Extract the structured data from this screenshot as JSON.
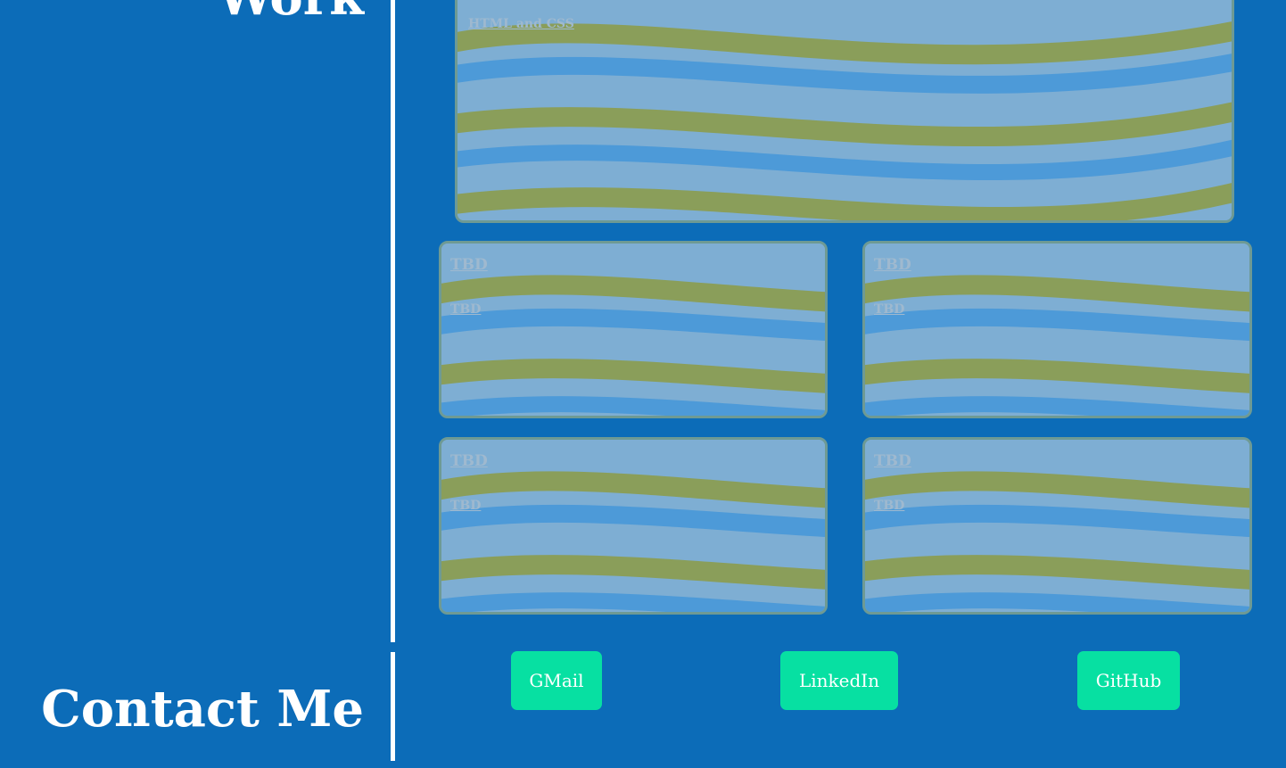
{
  "sections": {
    "work_title": "Work",
    "contact_title": "Contact Me"
  },
  "projects": {
    "featured": {
      "label": "HTML and CSS"
    },
    "cards": [
      {
        "title": "TBD",
        "subtitle": "TBD"
      },
      {
        "title": "TBD",
        "subtitle": "TBD"
      },
      {
        "title": "TBD",
        "subtitle": "TBD"
      },
      {
        "title": "TBD",
        "subtitle": "TBD"
      }
    ]
  },
  "contact": {
    "buttons": [
      {
        "label": "GMail"
      },
      {
        "label": "LinkedIn"
      },
      {
        "label": "GitHub"
      }
    ]
  },
  "colors": {
    "background": "#0c6cb8",
    "divider": "#ffffff",
    "button": "#07e0a2",
    "card_overlay": "#7fa7c8"
  }
}
